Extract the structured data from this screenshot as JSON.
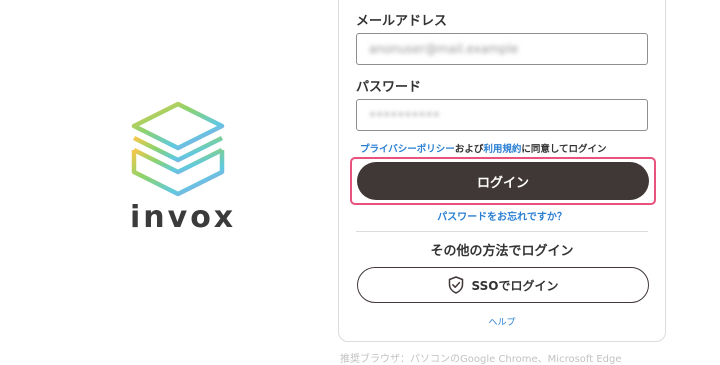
{
  "brand": {
    "name": "invox",
    "logo_icon": "stacked-layers-logo"
  },
  "form": {
    "email_label": "メールアドレス",
    "email_value": "anonuser@mail.example",
    "password_label": "パスワード",
    "password_value": "••••••••••",
    "consent": {
      "privacy_link": "プライバシーポリシー",
      "and": "および",
      "terms_link": "利用規約",
      "suffix": "に同意してログイン"
    },
    "login_button": "ログイン",
    "forgot_link": "パスワードをお忘れですか？",
    "other_methods": "その他の方法でログイン",
    "sso_button": "SSOでログイン",
    "help_link": "ヘルプ"
  },
  "footnote": "推奨ブラウザ：パソコンのGoogle Chrome、Microsoft Edge",
  "colors": {
    "primary_button": "#403836",
    "link": "#2a7fd3",
    "highlight": "#e8527c"
  }
}
